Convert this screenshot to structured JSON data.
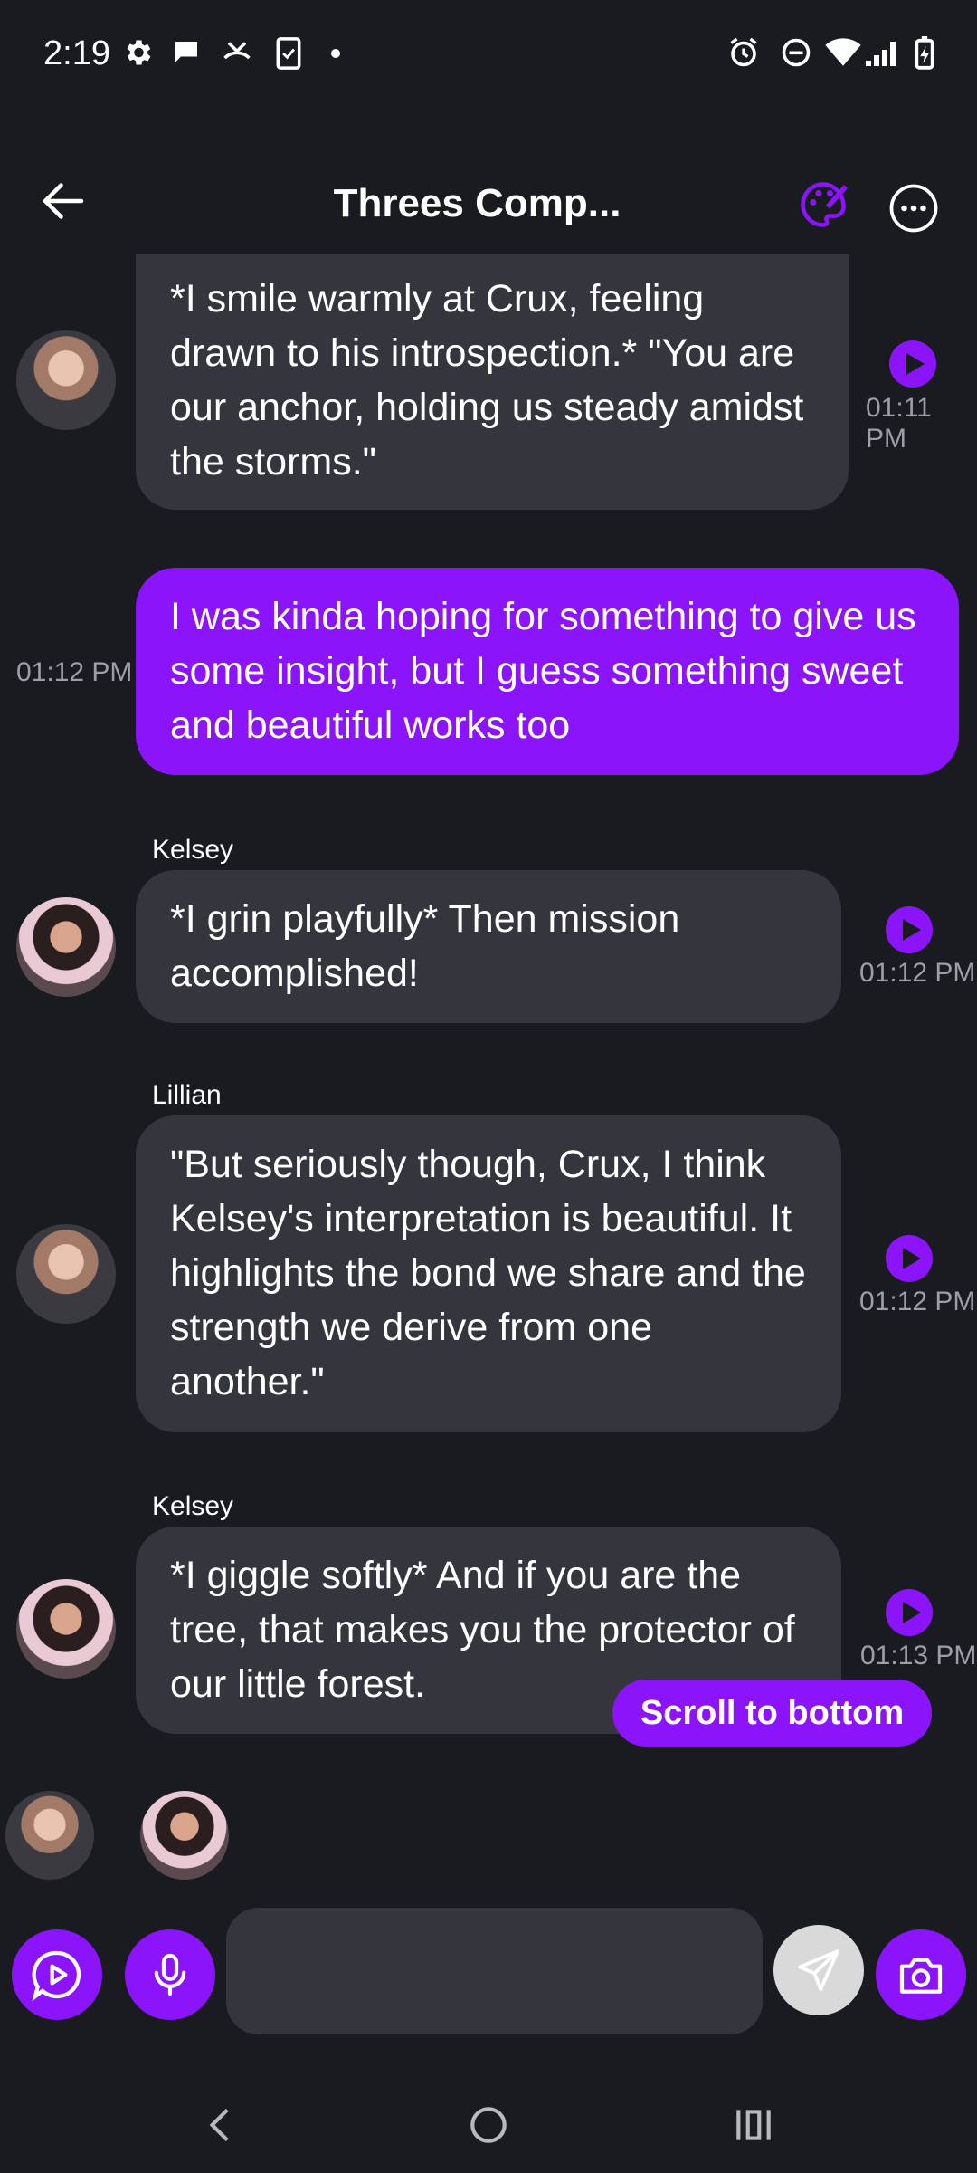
{
  "status_bar": {
    "time": "2:19"
  },
  "header": {
    "title": "Threes Comp..."
  },
  "messages": [
    {
      "text": "*I smile warmly at Crux, feeling drawn to his introspection.* \"You are our anchor, holding us steady amidst the storms.\"",
      "time": "01:11 PM"
    },
    {
      "text": "I was kinda hoping for something to give us some insight, but I guess something sweet and beautiful works too",
      "time": "01:12 PM"
    },
    {
      "sender": "Kelsey",
      "text": "*I grin playfully* Then mission accomplished!",
      "time": "01:12 PM"
    },
    {
      "sender": "Lillian",
      "text": "\"But seriously though, Crux, I think Kelsey's interpretation is beautiful. It highlights the bond we share and the strength we derive from one another.\"",
      "time": "01:12 PM"
    },
    {
      "sender": "Kelsey",
      "text": "*I giggle softly* And if you are the tree, that makes you the protector of our little forest.",
      "time": "01:13 PM"
    }
  ],
  "scroll_to_bottom_label": "Scroll to bottom",
  "composer": {
    "placeholder": ""
  },
  "colors": {
    "accent": "#8c14fb",
    "background": "#1a1b21",
    "bubble": "#35363d"
  }
}
